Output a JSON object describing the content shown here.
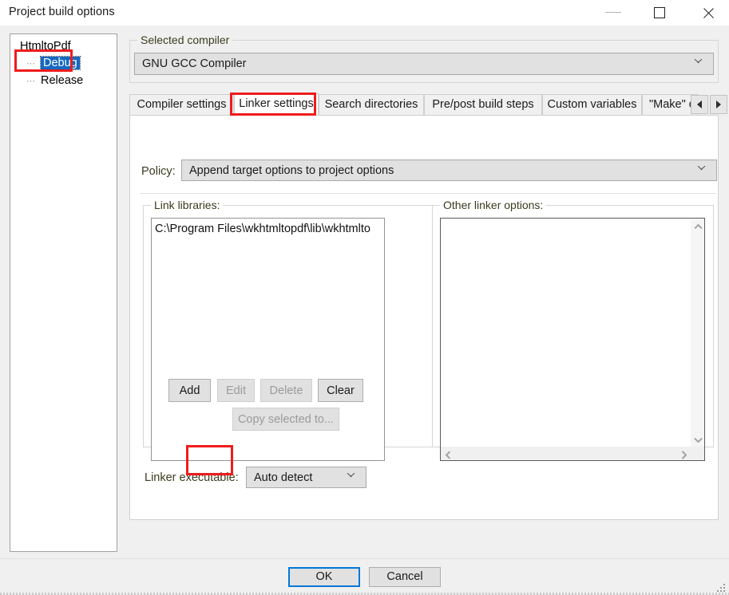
{
  "window": {
    "title": "Project build options",
    "controls": {
      "minimize": "minimize-icon",
      "maximize": "maximize-icon",
      "close": "close-icon"
    }
  },
  "tree": {
    "root": "HtmltoPdf",
    "children": [
      {
        "label": "Debug",
        "selected": true
      },
      {
        "label": "Release",
        "selected": false
      }
    ]
  },
  "compiler_group": {
    "title": "Selected compiler",
    "selected": "GNU GCC Compiler"
  },
  "tabs": {
    "items": [
      {
        "label": "Compiler settings",
        "selected": false
      },
      {
        "label": "Linker settings",
        "selected": true
      },
      {
        "label": "Search directories",
        "selected": false
      },
      {
        "label": "Pre/post build steps",
        "selected": false
      },
      {
        "label": "Custom variables",
        "selected": false
      },
      {
        "label": "\"Make\" c",
        "selected": false
      }
    ],
    "scroll_left": "scroll-left-icon",
    "scroll_right": "scroll-right-icon"
  },
  "policy": {
    "label": "Policy:",
    "value": "Append target options to project options"
  },
  "link_libraries": {
    "title": "Link libraries:",
    "items": [
      "C:\\Program Files\\wkhtmltopdf\\lib\\wkhtmlto"
    ],
    "buttons": {
      "add": "Add",
      "edit": "Edit",
      "delete": "Delete",
      "clear": "Clear",
      "copy_selected": "Copy selected to..."
    },
    "button_states": {
      "add": "enabled",
      "edit": "disabled",
      "delete": "disabled",
      "clear": "enabled",
      "copy_selected": "disabled"
    }
  },
  "move_buttons": {
    "up": "move-up-icon",
    "down": "move-down-icon"
  },
  "other_linker_options": {
    "title": "Other linker options:",
    "value": ""
  },
  "linker_executable": {
    "label": "Linker executable:",
    "value": "Auto detect"
  },
  "footer": {
    "ok": "OK",
    "cancel": "Cancel"
  },
  "annotations": {
    "color": "#ee1c1c",
    "boxes": [
      "Debug",
      "Linker settings",
      "Add"
    ]
  }
}
